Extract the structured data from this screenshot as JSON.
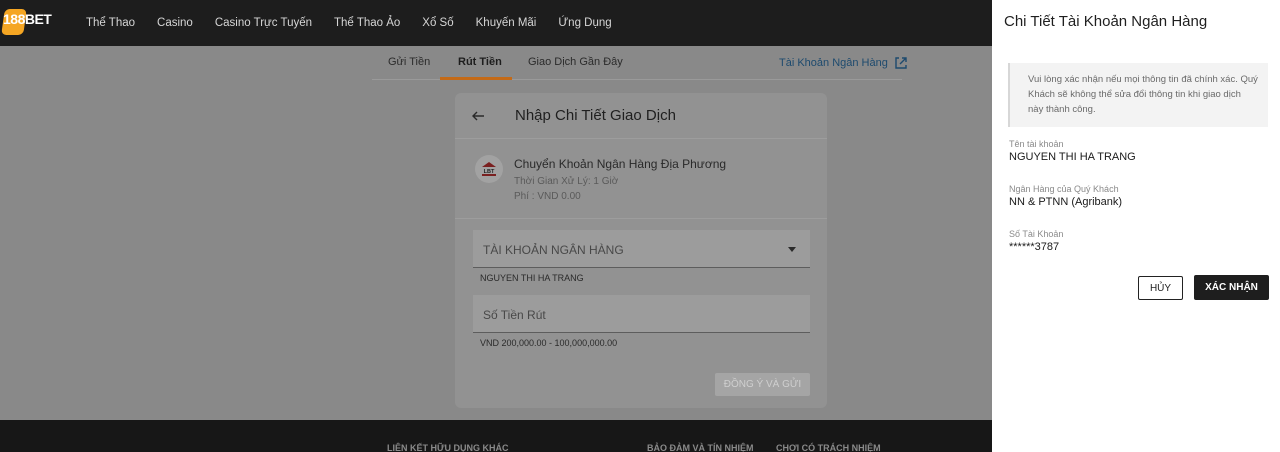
{
  "brand": {
    "logo_text": "188BET",
    "accent": "#f5a623"
  },
  "nav": [
    "Thể Thao",
    "Casino",
    "Casino Trực Tuyến",
    "Thể Thao Ảo",
    "Xổ Số",
    "Khuyến Mãi",
    "Ứng Dụng"
  ],
  "tabs": {
    "deposit": "Gửi Tiền",
    "withdraw": "Rút Tiền",
    "recent": "Giao Dịch Gần Đây",
    "bank_link": "Tài Khoản Ngân Hàng"
  },
  "card": {
    "title": "Nhập Chi Tiết Giao Dịch",
    "method_name": "Chuyển Khoản Ngân Hàng Địa Phương",
    "method_time": "Thời Gian Xử Lý: 1 Giờ",
    "method_fee": "Phí : VND 0.00",
    "bank_icon_text": "LBT",
    "bank_account_placeholder": "TÀI KHOẢN NGÂN HÀNG",
    "bank_account_helper": "NGUYEN THI HA TRANG",
    "amount_placeholder": "Số Tiền Rút",
    "amount_helper": "VND 200,000.00 - 100,000,000.00",
    "submit_label": "ĐỒNG Ý VÀ GỬI"
  },
  "footer": [
    "LIÊN KẾT HỮU DỤNG KHÁC",
    "BẢO ĐẢM VÀ TÍN NHIỆM",
    "CHƠI CÓ TRÁCH NHIỆM"
  ],
  "drawer": {
    "title": "Chi Tiết Tài Khoản Ngân Hàng",
    "notice": "Vui lòng xác nhận nếu mọi thông tin đã chính xác. Quý Khách sẽ không thể sửa đổi thông tin khi giao dịch này thành công.",
    "account_name_label": "Tên tài khoản",
    "account_name": "NGUYEN THI HA TRANG",
    "bank_label": "Ngân Hàng của Quý Khách",
    "bank": "NN & PTNN (Agribank)",
    "account_no_label": "Số Tài Khoản",
    "account_no": "******3787",
    "cancel_label": "HỦY",
    "confirm_label": "XÁC NHẬN"
  }
}
